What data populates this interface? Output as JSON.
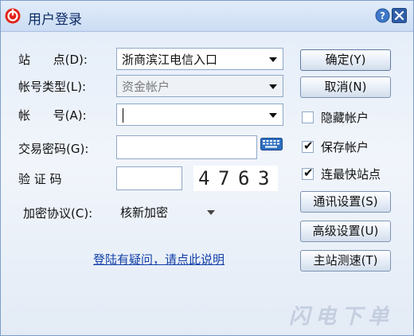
{
  "window": {
    "title": "用户登录",
    "help_button": "?",
    "close_button": "✕"
  },
  "form": {
    "site_label": "站      点(D):",
    "site_value": "浙商滨江电信入口",
    "account_type_label": "帐号类型(L):",
    "account_type_value": "资金帐户",
    "account_label": "帐      号(A):",
    "account_value": "",
    "password_label": "交易密码(G):",
    "password_value": "",
    "captcha_label": "验 证 码",
    "captcha_input_value": "",
    "captcha_digits": [
      "4",
      "7",
      "6",
      "3"
    ],
    "encryption_label": "加密协议(C):",
    "encryption_value": "核新加密",
    "help_link": "登陆有疑问，请点此说明"
  },
  "buttons": {
    "ok": "确定(Y)",
    "cancel": "取消(N)",
    "comm_settings": "通讯设置(S)",
    "advanced_settings": "高级设置(U)",
    "speed_test": "主站测速(T)"
  },
  "options": {
    "hide_account": {
      "label": "隐藏帐户",
      "checked": false
    },
    "save_account": {
      "label": "保存帐户",
      "checked": true
    },
    "fastest_site": {
      "label": "连最快站点",
      "checked": true
    },
    "check_mark": "✔"
  },
  "watermark": "闪电下单",
  "colors": {
    "title_text": "#0c2a66",
    "link": "#1340a8",
    "app_icon": "#e2231a",
    "close_button": "#2f5ea8",
    "help_button": "#3f78c8"
  }
}
